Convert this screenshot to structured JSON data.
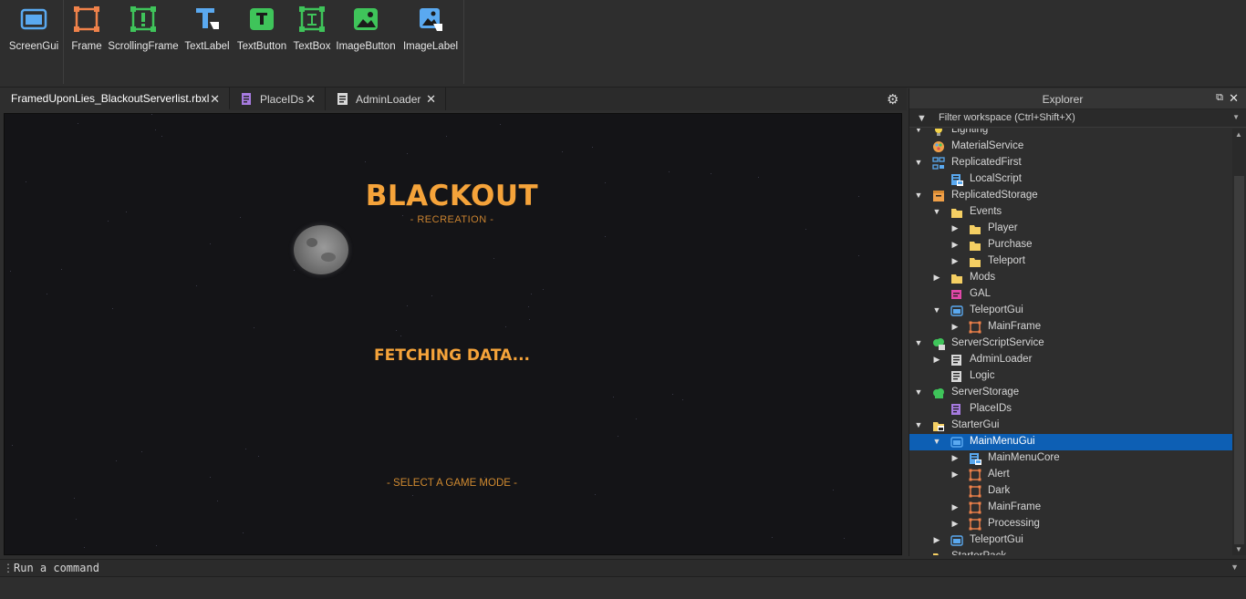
{
  "toolbar": {
    "tools": [
      {
        "label": "ScreenGui",
        "icon": "screengui-icon"
      },
      {
        "label": "Frame",
        "icon": "frame-icon"
      },
      {
        "label": "ScrollingFrame",
        "icon": "scrollingframe-icon"
      },
      {
        "label": "TextLabel",
        "icon": "textlabel-icon"
      },
      {
        "label": "TextButton",
        "icon": "textbutton-icon"
      },
      {
        "label": "TextBox",
        "icon": "textbox-icon"
      },
      {
        "label": "ImageButton",
        "icon": "imagebutton-icon"
      },
      {
        "label": "ImageLabel",
        "icon": "imagelabel-icon"
      }
    ]
  },
  "tabs": [
    {
      "label": "FramedUponLies_BlackoutServerlist.rbxl",
      "active": true
    },
    {
      "label": "PlaceIDs",
      "active": false
    },
    {
      "label": "AdminLoader",
      "active": false
    }
  ],
  "viewport": {
    "title": "BLACKOUT",
    "subtitle": "- RECREATION -",
    "status": "FETCHING DATA...",
    "footer": "- SELECT A GAME MODE -"
  },
  "command_bar": {
    "placeholder": "Run a command"
  },
  "explorer": {
    "title": "Explorer",
    "filter_placeholder": "Filter workspace (Ctrl+Shift+X)",
    "items": [
      {
        "label": "Lighting",
        "depth": 0,
        "arrow": "down",
        "icon": "lighting-icon",
        "selected": false
      },
      {
        "label": "MaterialService",
        "depth": 0,
        "arrow": "",
        "icon": "materialservice-icon",
        "selected": false
      },
      {
        "label": "ReplicatedFirst",
        "depth": 0,
        "arrow": "down",
        "icon": "replicatedfirst-icon",
        "selected": false
      },
      {
        "label": "LocalScript",
        "depth": 1,
        "arrow": "",
        "icon": "localscript-icon",
        "selected": false
      },
      {
        "label": "ReplicatedStorage",
        "depth": 0,
        "arrow": "down",
        "icon": "replicatedstorage-icon",
        "selected": false
      },
      {
        "label": "Events",
        "depth": 1,
        "arrow": "down",
        "icon": "folder-icon",
        "selected": false
      },
      {
        "label": "Player",
        "depth": 2,
        "arrow": "right",
        "icon": "folder-icon",
        "selected": false
      },
      {
        "label": "Purchase",
        "depth": 2,
        "arrow": "right",
        "icon": "folder-icon",
        "selected": false
      },
      {
        "label": "Teleport",
        "depth": 2,
        "arrow": "right",
        "icon": "folder-icon",
        "selected": false
      },
      {
        "label": "Mods",
        "depth": 1,
        "arrow": "right",
        "icon": "folder-icon",
        "selected": false
      },
      {
        "label": "GAL",
        "depth": 1,
        "arrow": "",
        "icon": "module-icon",
        "selected": false
      },
      {
        "label": "TeleportGui",
        "depth": 1,
        "arrow": "down",
        "icon": "screengui-icon",
        "selected": false
      },
      {
        "label": "MainFrame",
        "depth": 2,
        "arrow": "right",
        "icon": "frame-icon",
        "selected": false
      },
      {
        "label": "ServerScriptService",
        "depth": 0,
        "arrow": "down",
        "icon": "serverscriptservice-icon",
        "selected": false
      },
      {
        "label": "AdminLoader",
        "depth": 1,
        "arrow": "right",
        "icon": "script-icon",
        "selected": false
      },
      {
        "label": "Logic",
        "depth": 1,
        "arrow": "",
        "icon": "script-icon",
        "selected": false
      },
      {
        "label": "ServerStorage",
        "depth": 0,
        "arrow": "down",
        "icon": "serverstorage-icon",
        "selected": false
      },
      {
        "label": "PlaceIDs",
        "depth": 1,
        "arrow": "",
        "icon": "modulescript-icon",
        "selected": false
      },
      {
        "label": "StarterGui",
        "depth": 0,
        "arrow": "down",
        "icon": "startergui-icon",
        "selected": false
      },
      {
        "label": "MainMenuGui",
        "depth": 1,
        "arrow": "down",
        "icon": "screengui-icon",
        "selected": true
      },
      {
        "label": "MainMenuCore",
        "depth": 2,
        "arrow": "right",
        "icon": "localscript-icon",
        "selected": false
      },
      {
        "label": "Alert",
        "depth": 2,
        "arrow": "right",
        "icon": "frame-icon",
        "selected": false
      },
      {
        "label": "Dark",
        "depth": 2,
        "arrow": "",
        "icon": "frame-icon",
        "selected": false
      },
      {
        "label": "MainFrame",
        "depth": 2,
        "arrow": "right",
        "icon": "frame-icon",
        "selected": false
      },
      {
        "label": "Processing",
        "depth": 2,
        "arrow": "right",
        "icon": "frame-icon",
        "selected": false
      },
      {
        "label": "TeleportGui",
        "depth": 1,
        "arrow": "right",
        "icon": "screengui-icon",
        "selected": false
      },
      {
        "label": "StarterPack",
        "depth": 0,
        "arrow": "",
        "icon": "starterpack-icon",
        "selected": false
      }
    ]
  },
  "colors": {
    "accent": "#f5a33a",
    "selection": "#0d5fb4",
    "background": "#2e2e2e"
  }
}
